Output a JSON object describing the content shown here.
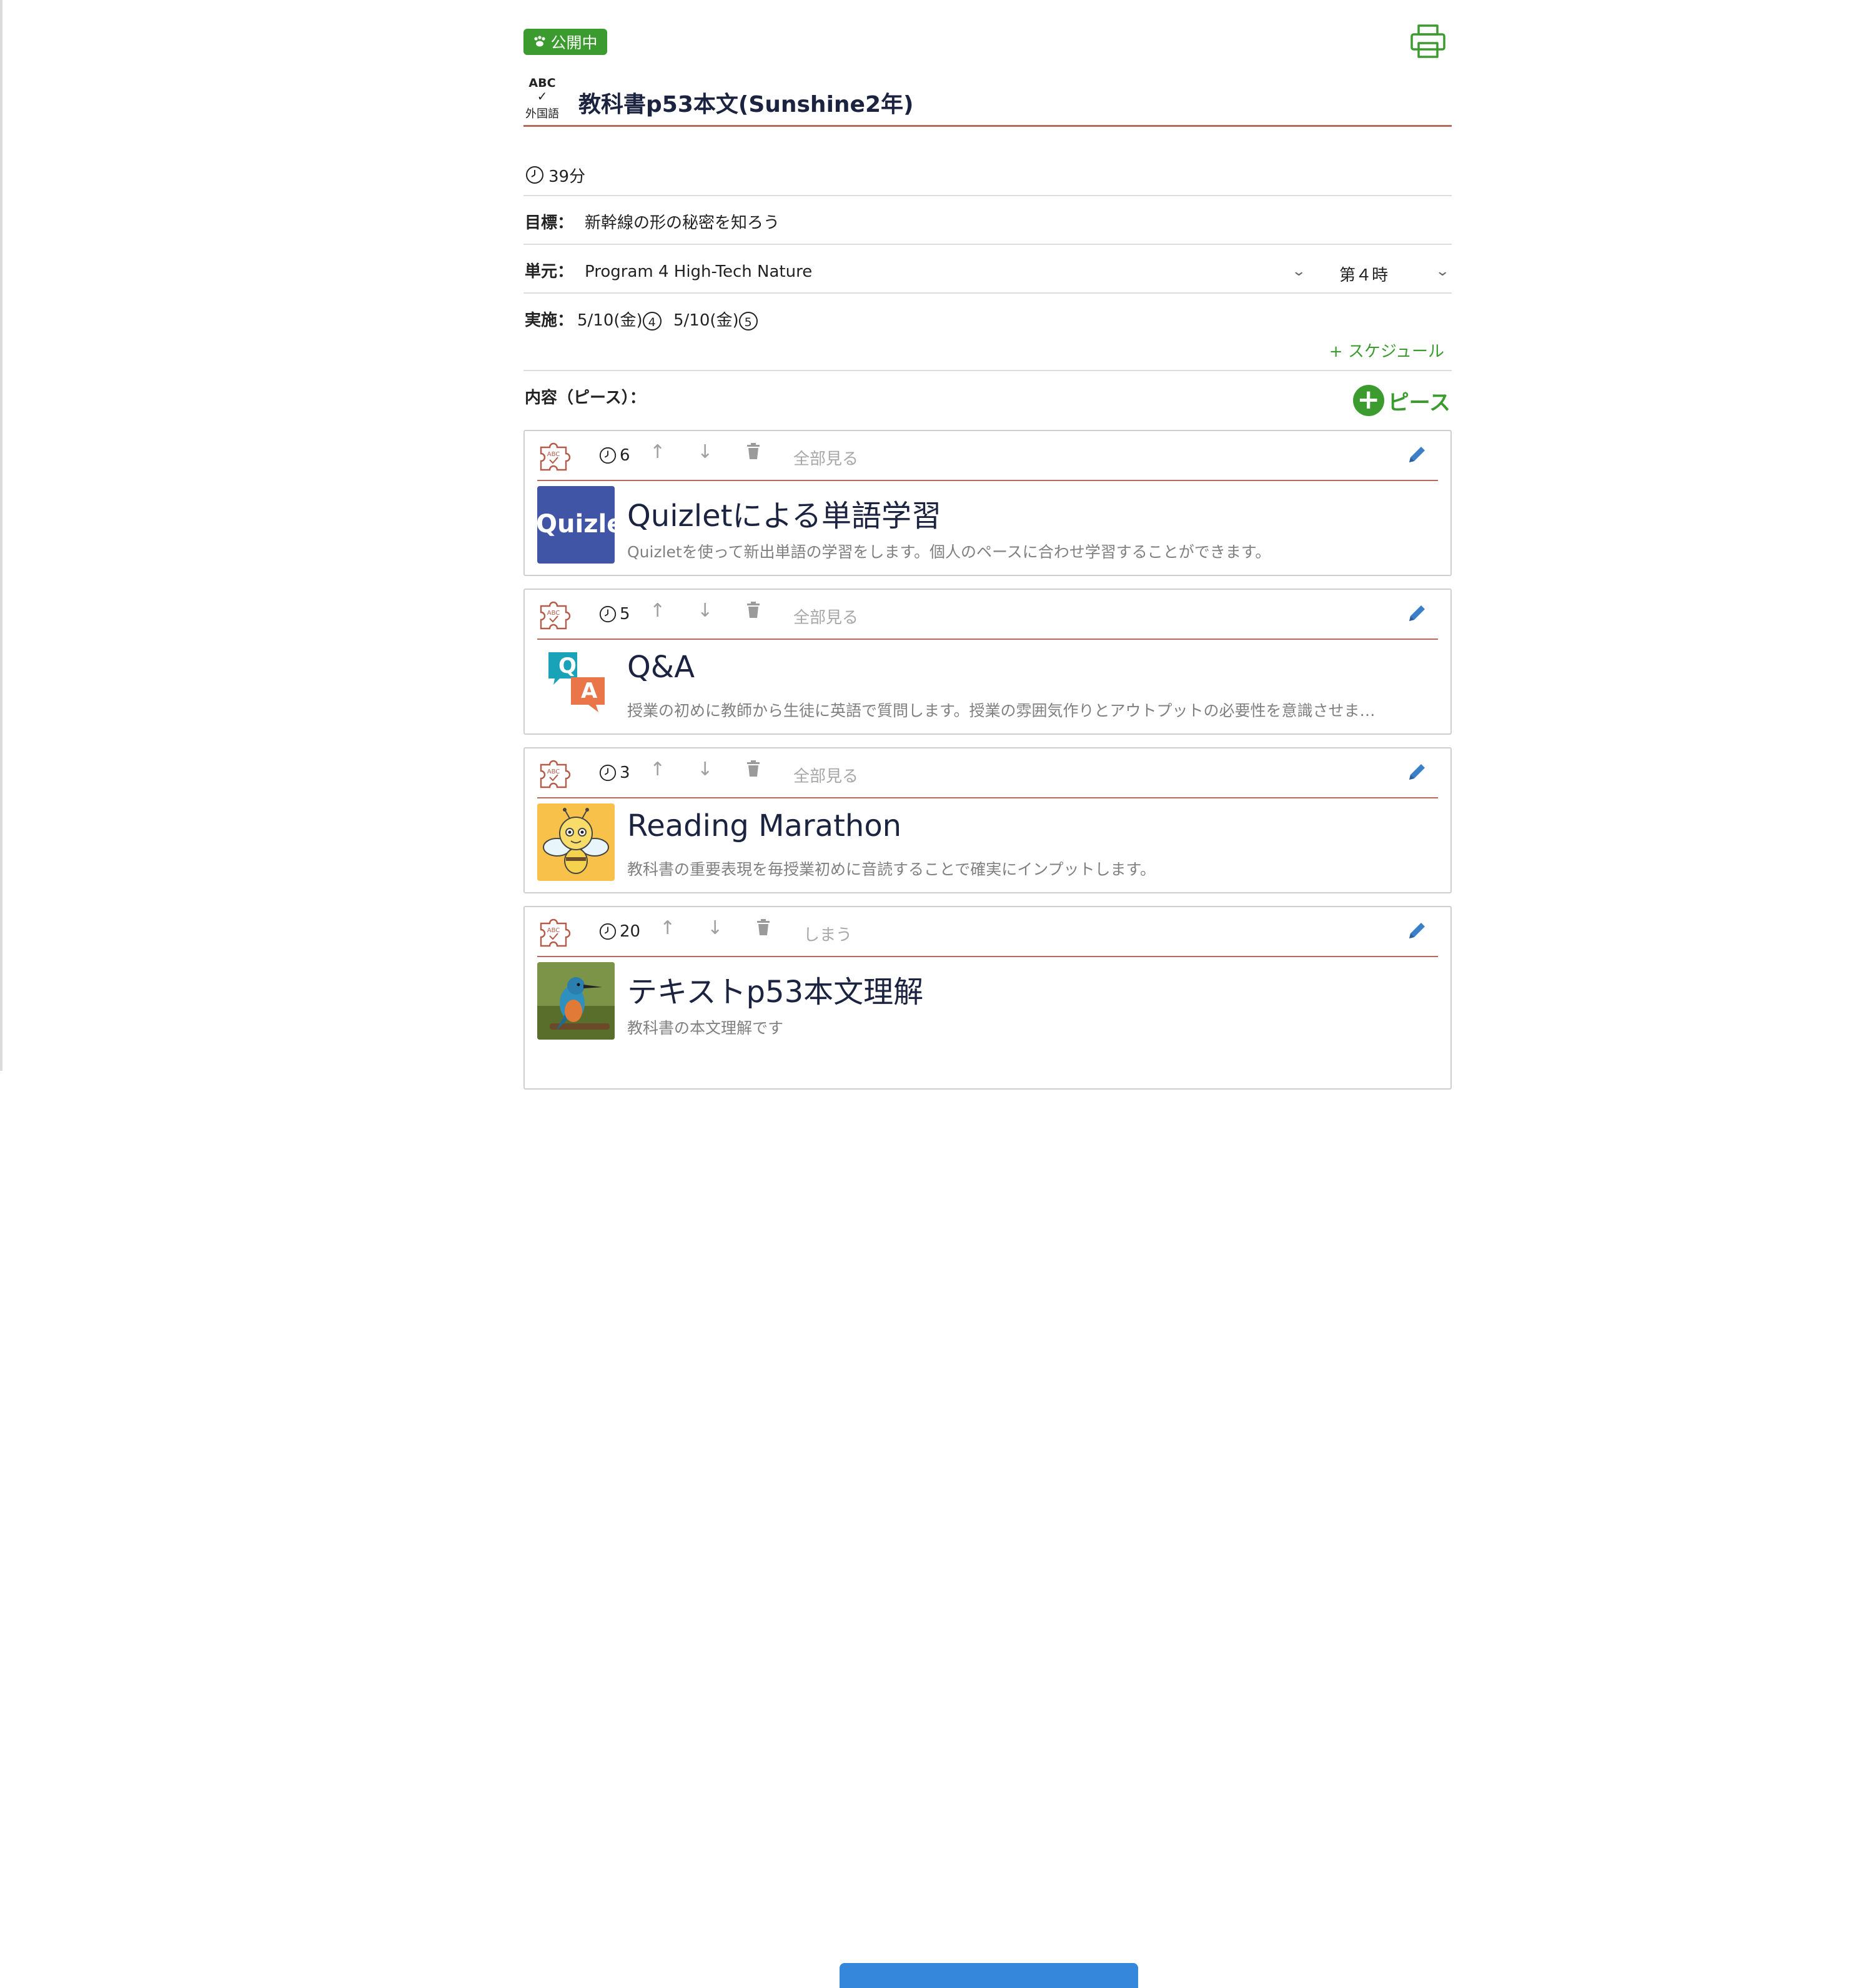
{
  "header": {
    "status_badge": "公開中",
    "subject": {
      "abc": "ABC",
      "label": "外国語"
    },
    "title": "教科書p53本文(Sunshine2年)"
  },
  "duration": "39分",
  "goal": {
    "label": "目標：",
    "value": "新幹線の形の秘密を知ろう"
  },
  "unit": {
    "label": "単元：",
    "value": "Program 4 High-Tech Nature",
    "period": "第４時"
  },
  "schedule": {
    "label": "実施：",
    "dates": [
      {
        "date": "5/10(金)",
        "period": "4"
      },
      {
        "date": "5/10(金)",
        "period": "5"
      }
    ],
    "add_label": "+ スケジュール"
  },
  "content": {
    "label": "内容（ピース）：",
    "add_piece_label": "ピース"
  },
  "pieces": [
    {
      "minutes": "6",
      "toggle": "全部見る",
      "title": "Quizletによる単語学習",
      "description": "Quizletを使って新出単語の学習をします。個人のペースに合わせ学習することができます。",
      "thumb_text": "Quizlet"
    },
    {
      "minutes": "5",
      "toggle": "全部見る",
      "title": "Q&A",
      "description": "授業の初めに教師から生徒に英語で質問します。授業の雰囲気作りとアウトプットの必要性を意識させま…",
      "thumb_q": "Q",
      "thumb_a": "A"
    },
    {
      "minutes": "3",
      "toggle": "全部見る",
      "title": "Reading Marathon",
      "description": "教科書の重要表現を毎授業初めに音読することで確実にインプットします。"
    },
    {
      "minutes": "20",
      "toggle": "しまう",
      "title": "テキストp53本文理解",
      "description": "教科書の本文理解です"
    }
  ],
  "colors": {
    "accent_green": "#3b9b2f",
    "rule_brown": "#b46a5a",
    "edit_blue": "#3a7fc8",
    "primary_blue": "#3587dc"
  }
}
